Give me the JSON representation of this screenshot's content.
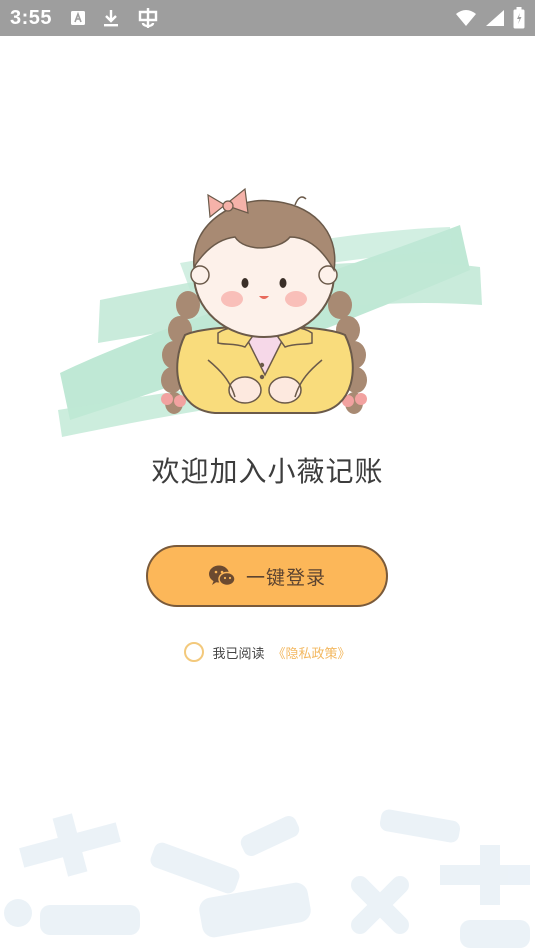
{
  "status_bar": {
    "time": "3:55"
  },
  "welcome": {
    "title": "欢迎加入小薇记账"
  },
  "login": {
    "label": "一键登录"
  },
  "agreement": {
    "prefix": "我已阅读",
    "link": "《隐私政策》"
  },
  "colors": {
    "accent": "#fcb759",
    "button_border": "#7a5a3a",
    "link": "#f3b860",
    "brush": "#bfe8d5"
  },
  "icons": {
    "login": "wechat-icon",
    "status": [
      "keyboard-icon",
      "download-icon",
      "bug-icon",
      "wifi-icon",
      "signal-icon",
      "battery-icon"
    ]
  }
}
